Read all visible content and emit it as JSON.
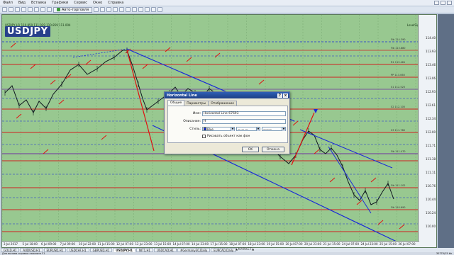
{
  "menu": [
    "Файл",
    "Вид",
    "Вставка",
    "Графики",
    "Сервис",
    "Окно",
    "Справка"
  ],
  "toolbar": {
    "auto_trading": "Авто-торговля"
  },
  "chart": {
    "symbol": "USDJPY",
    "ohlc_text": "USDJPY,H1  110.859 111.029 110.859 111.004",
    "indicator_text": "LevelSignal_AC_v3",
    "price_labels": [
      "114.40",
      "113.93",
      "113.46",
      "113.06",
      "112.93",
      "112.61",
      "112.34",
      "112.00",
      "111.71",
      "111.38",
      "111.11",
      "110.76",
      "110.44",
      "110.24",
      "110.00"
    ],
    "time_labels": [
      "3 Jul 2017",
      "5 Jul 18:00",
      "6 Jul 09:00",
      "7 Jul 09:00",
      "10 Jul 22:00",
      "11 Jul 15:00",
      "12 Jul 07:00",
      "12 Jul 23:00",
      "13 Jul 15:00",
      "14 Jul 07:00",
      "14 Jul 23:00",
      "17 Jul 15:00",
      "18 Jul 07:00",
      "18 Jul 23:00",
      "19 Jul 15:00",
      "20 Jul 07:00",
      "20 Jul 23:00",
      "21 Jul 15:00",
      "24 Jul 07:00",
      "24 Jul 23:00",
      "25 Jul 15:00",
      "26 Jul 07:00"
    ],
    "level_labels": [
      "Fib 114.390",
      "Fib 113.880",
      "R1 113.461",
      "PP 113.060",
      "S1 112.520",
      "S2 112.105",
      "S3 111.780",
      "Fib 111.470",
      "Fib 111.102",
      "Fib 110.690"
    ]
  },
  "dialog": {
    "title": "Horizontal Line",
    "tabs": [
      "Общие",
      "Параметры",
      "Отображение"
    ],
    "name_label": "Имя:",
    "name_value": "Horizontal Line 67693",
    "desc_label": "Описание:",
    "desc_value": "H",
    "style_label": "Стиль:",
    "color_value": "Blue",
    "checkbox_label": "Рисовать объект как фон",
    "ok_label": "OK",
    "cancel_label": "Отмена"
  },
  "tabs": [
    "GOLD,H1",
    "AUDUSD,H1",
    "EURUSD,H1",
    "USDCHF,H1",
    "GBPUSD,H1",
    "USDJPY,H1",
    "NIT1,H1",
    "USDCAD,H1",
    "#Germany30,Daily",
    "EURCAD,Daily"
  ],
  "market_watch": "▲MARKET▲",
  "status": {
    "help": "Для вызова справки нажмите F1",
    "traffic": "30770/15 kb"
  }
}
